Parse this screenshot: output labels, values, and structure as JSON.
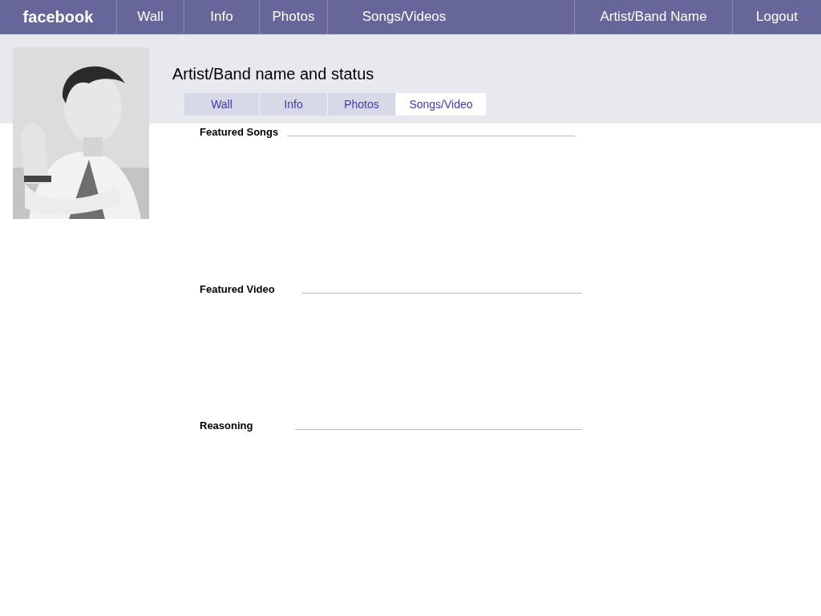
{
  "nav": {
    "logo": "facebook",
    "items": [
      {
        "label": "Wall"
      },
      {
        "label": "Info"
      },
      {
        "label": "Photos"
      },
      {
        "label": "Songs/Videos"
      }
    ],
    "right_items": [
      {
        "label": "Artist/Band Name"
      },
      {
        "label": "Logout"
      }
    ]
  },
  "profile": {
    "title": "Artist/Band name and status"
  },
  "tabs": [
    {
      "label": "Wall",
      "selected": false
    },
    {
      "label": "Info",
      "selected": false
    },
    {
      "label": "Photos",
      "selected": false
    },
    {
      "label": "Songs/Video",
      "selected": true
    }
  ],
  "sections": [
    {
      "heading": "Featured Songs"
    },
    {
      "heading": "Featured Video"
    },
    {
      "heading": "Reasoning"
    }
  ]
}
